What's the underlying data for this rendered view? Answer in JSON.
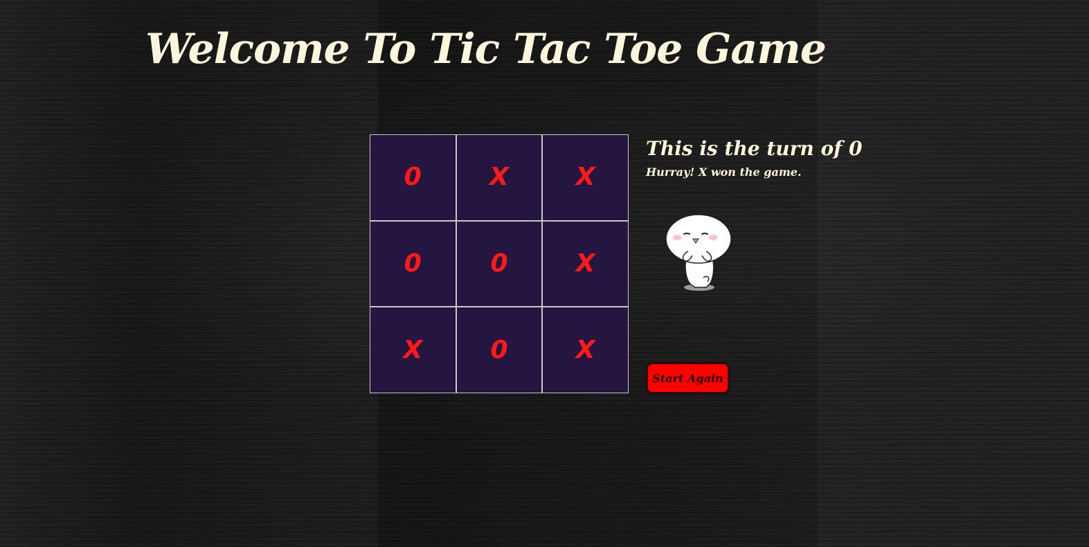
{
  "header": {
    "title": "Welcome To Tic Tac Toe Game"
  },
  "board": {
    "cells": [
      "0",
      "X",
      "X",
      "0",
      "0",
      "X",
      "X",
      "0",
      "X"
    ]
  },
  "info": {
    "turn_text": "This is the turn of 0",
    "status_text": "Hurray! X won the game."
  },
  "controls": {
    "reset_label": "Start Again"
  },
  "colors": {
    "title": "#fff6dc",
    "cell_background": "#241640",
    "mark": "#ff1a1a",
    "button": "#ff0000"
  },
  "icons": {
    "mascot": "celebrating-mascot-icon"
  }
}
